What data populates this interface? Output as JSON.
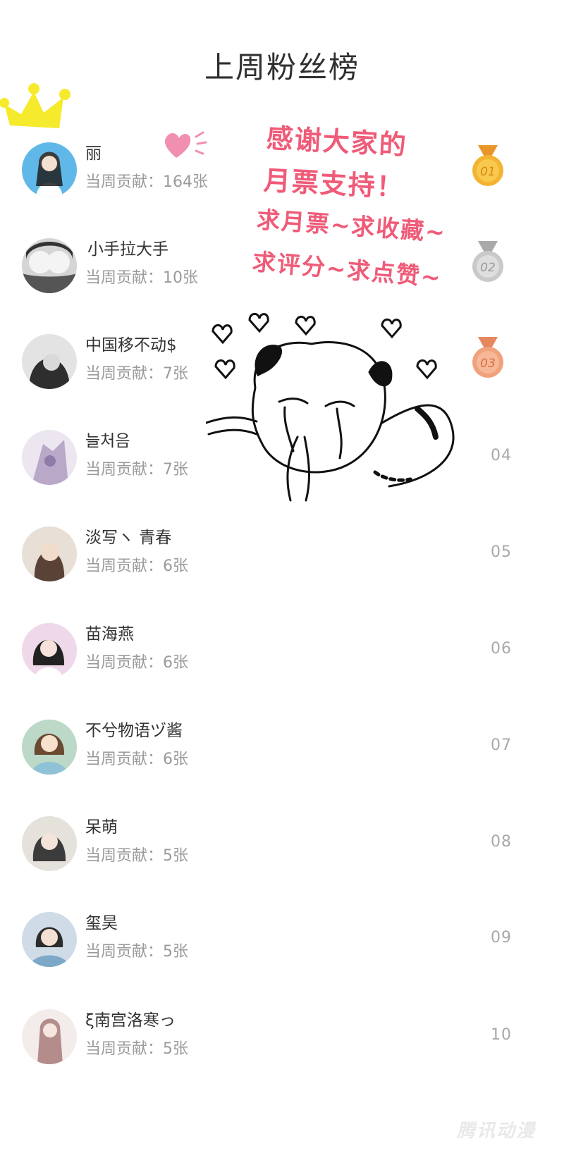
{
  "header": {
    "title": "上周粉丝榜"
  },
  "contribution_prefix": "当周贡献：",
  "fans": [
    {
      "rank": "01",
      "name": "丽",
      "contribution": "当周贡献：164张",
      "medal": "gold",
      "avatar_color": "#5fb8e8"
    },
    {
      "rank": "02",
      "name": "小手拉大手",
      "contribution": "当周贡献：10张",
      "medal": "silver",
      "avatar_color": "#8a8a8a"
    },
    {
      "rank": "03",
      "name": "中国移不动$",
      "contribution": "当周贡献：7张",
      "medal": "bronze",
      "avatar_color": "#4a4a4a"
    },
    {
      "rank": "04",
      "name": "늘처음",
      "contribution": "当周贡献：7张",
      "medal": "",
      "avatar_color": "#b9a8c8"
    },
    {
      "rank": "05",
      "name": "淡写ヽ 青春",
      "contribution": "当周贡献：6张",
      "medal": "",
      "avatar_color": "#c9b6a8"
    },
    {
      "rank": "06",
      "name": "苗海燕",
      "contribution": "当周贡献：6张",
      "medal": "",
      "avatar_color": "#e7cbe2"
    },
    {
      "rank": "07",
      "name": "不兮物语ヅ酱",
      "contribution": "当周贡献：6张",
      "medal": "",
      "avatar_color": "#8fc2b6"
    },
    {
      "rank": "08",
      "name": "呆萌",
      "contribution": "当周贡献：5张",
      "medal": "",
      "avatar_color": "#d8d2c8"
    },
    {
      "rank": "09",
      "name": "玺昊",
      "contribution": "当周贡献：5张",
      "medal": "",
      "avatar_color": "#7da8c8"
    },
    {
      "rank": "10",
      "name": "ξ南宫洛寒っ",
      "contribution": "当周贡献：5张",
      "medal": "",
      "avatar_color": "#e6d6d6"
    }
  ],
  "sticker": {
    "lines": [
      "感谢大家的",
      "月票支持！",
      "求月票~求收藏~",
      "求评分~求点赞~"
    ],
    "color": "#ef5b78"
  },
  "watermark": "腾讯动漫",
  "colors": {
    "gold": "#f3b432",
    "silver": "#c9c9c9",
    "bronze": "#f0a27c",
    "crown": "#f6ea2c"
  }
}
